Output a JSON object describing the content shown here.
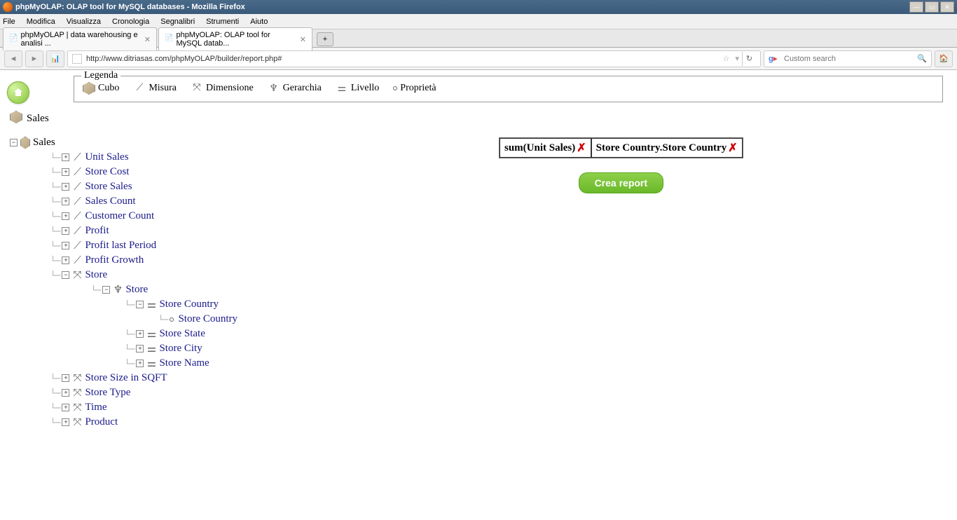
{
  "window": {
    "title": "phpMyOLAP: OLAP tool for MySQL databases - Mozilla Firefox"
  },
  "menubar": {
    "items": [
      "File",
      "Modifica",
      "Visualizza",
      "Cronologia",
      "Segnalibri",
      "Strumenti",
      "Aiuto"
    ]
  },
  "tabs": [
    {
      "label": "phpMyOLAP | data warehousing e analisi ..."
    },
    {
      "label": "phpMyOLAP: OLAP tool for MySQL datab..."
    }
  ],
  "url": "http://www.ditriasas.com/phpMyOLAP/builder/report.php#",
  "search": {
    "placeholder": "Custom search"
  },
  "legend": {
    "title": "Legenda",
    "items": [
      "Cubo",
      "Misura",
      "Dimensione",
      "Gerarchia",
      "Livello",
      "Proprietà"
    ]
  },
  "cube_name": "Sales",
  "tree": {
    "root": "Sales",
    "measures": [
      "Unit Sales",
      "Store Cost",
      "Store Sales",
      "Sales Count",
      "Customer Count",
      "Profit",
      "Profit last Period",
      "Profit Growth"
    ],
    "store_dim": "Store",
    "store_hier": "Store",
    "store_levels": [
      "Store Country",
      "Store State",
      "Store City",
      "Store Name"
    ],
    "store_country_prop": "Store Country",
    "other_dims": [
      "Store Size in SQFT",
      "Store Type",
      "Time",
      "Product"
    ]
  },
  "selected": {
    "measure": "sum(Unit Sales)",
    "dimension": "Store Country.Store Country"
  },
  "create_button": "Crea report"
}
